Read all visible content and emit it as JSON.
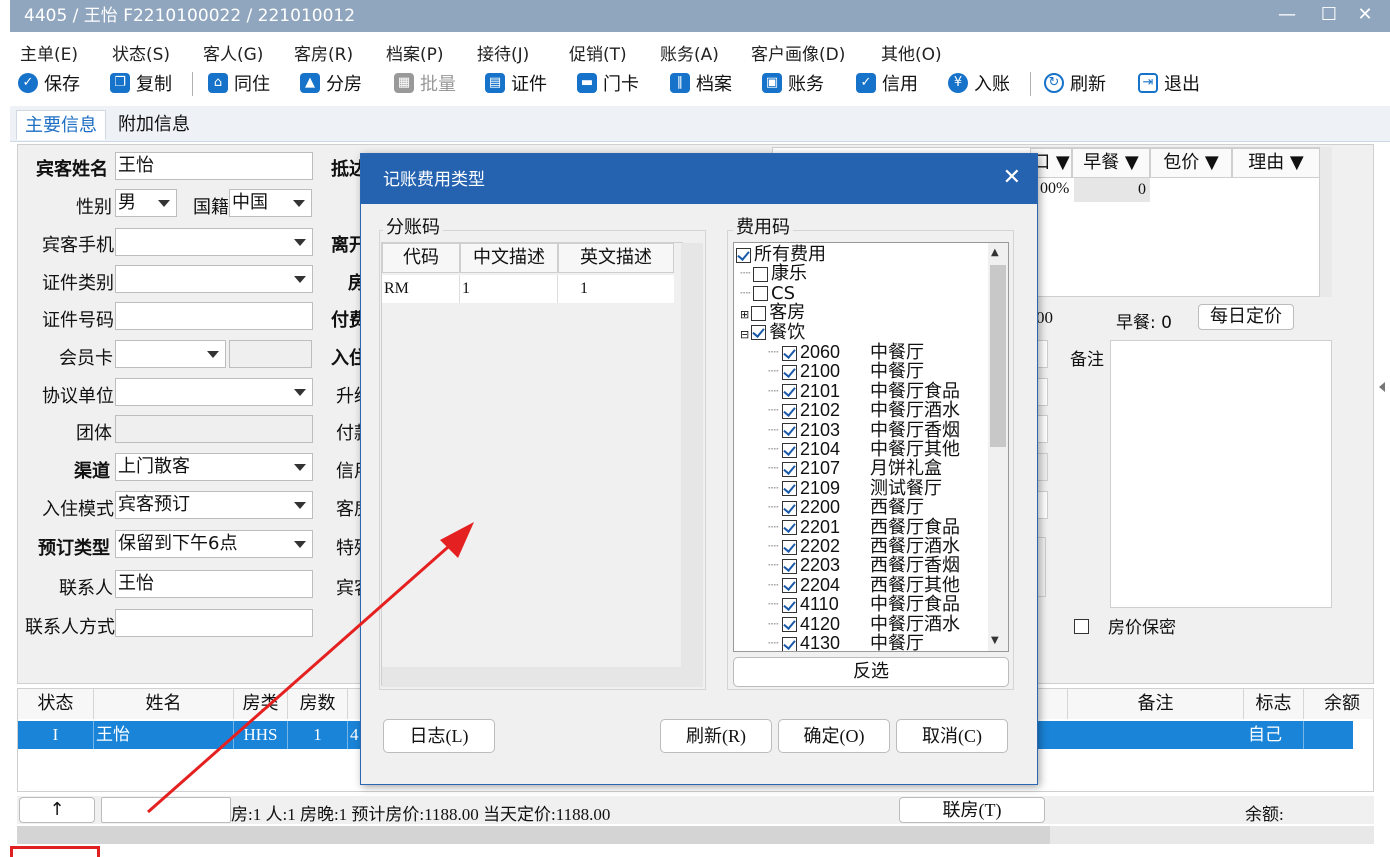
{
  "window": {
    "title": "4405 / 王怡 F2210100022 / 221010012",
    "min": "—",
    "max": "☐",
    "close": "✕"
  },
  "menu": [
    "主单(E)",
    "状态(S)",
    "客人(G)",
    "客房(R)",
    "档案(P)",
    "接待(J)",
    "促销(T)",
    "账务(A)",
    "客户画像(D)",
    "其他(O)"
  ],
  "toolbar": {
    "save": "保存",
    "copy": "复制",
    "cohabit": "同住",
    "assign": "分房",
    "batch": "批量",
    "idcard": "证件",
    "doorcard": "门卡",
    "profile": "档案",
    "account": "账务",
    "credit": "信用",
    "post": "入账",
    "refresh": "刷新",
    "exit": "退出"
  },
  "tabs": {
    "main": "主要信息",
    "extra": "附加信息"
  },
  "form": {
    "guest_name_label": "宾客姓名",
    "guest_name": "王怡",
    "gender_label": "性别",
    "gender": "男",
    "nation_label": "国籍",
    "nation": "中国",
    "phone_label": "宾客手机",
    "phone": "",
    "idtype_label": "证件类别",
    "idtype": "",
    "idno_label": "证件号码",
    "idno": "",
    "member_label": "会员卡",
    "member": "",
    "agreement_label": "协议单位",
    "agreement": "",
    "group_label": "团体",
    "group": "",
    "channel_label": "渠道",
    "channel": "上门散客",
    "checkin_mode_label": "入住模式",
    "checkin_mode": "宾客预订",
    "book_type_label": "预订类型",
    "book_type": "保留到下午6点",
    "contact_label": "联系人",
    "contact": "王怡",
    "contact_way_label": "联系人方式",
    "contact_way": "",
    "col2": [
      "抵达",
      "离开",
      "房",
      "付费",
      "入住",
      "升级",
      "付款",
      "信用",
      "客房",
      "特殊",
      "宾客"
    ]
  },
  "price_grid": {
    "headers": [
      "口 ▼",
      "早餐 ▼",
      "包价 ▼",
      "理由 ▼"
    ],
    "row": [
      "00%",
      "0",
      "",
      ""
    ]
  },
  "right": {
    "left_value": "00",
    "breakfast": "早餐: 0",
    "daily_price_btn": "每日定价",
    "remark_label": "备注",
    "price_secret": "房价保密"
  },
  "bottom_grid": {
    "headers": [
      "状态",
      "姓名",
      "房类",
      "房数",
      "备注",
      "标志",
      "余额"
    ],
    "row": {
      "status": "I",
      "name": "王怡",
      "type": "HHS",
      "count": "1",
      "extra": "4",
      "flag": "自己"
    }
  },
  "status_bar": {
    "up_btn": "↑",
    "summary": "房:1  人:1  房晚:1  预计房价:1188.00  当天定价:1188.00",
    "link_btn": "联房(T)",
    "balance": "余额:"
  },
  "dialog": {
    "title": "记账费用类型",
    "sub_title": "分账码",
    "sub_headers": [
      "代码",
      "中文描述",
      "英文描述"
    ],
    "sub_rows": [
      [
        "RM",
        "1",
        "1"
      ]
    ],
    "fee_title": "费用码",
    "tree_root": "所有费用",
    "tree_top": [
      "康乐",
      "CS",
      "客房",
      "餐饮"
    ],
    "items": [
      {
        "code": "2060",
        "name": "中餐厅"
      },
      {
        "code": "2100",
        "name": "中餐厅"
      },
      {
        "code": "2101",
        "name": "中餐厅食品"
      },
      {
        "code": "2102",
        "name": "中餐厅酒水"
      },
      {
        "code": "2103",
        "name": "中餐厅香烟"
      },
      {
        "code": "2104",
        "name": "中餐厅其他"
      },
      {
        "code": "2107",
        "name": "月饼礼盒"
      },
      {
        "code": "2109",
        "name": "测试餐厅"
      },
      {
        "code": "2200",
        "name": "西餐厅"
      },
      {
        "code": "2201",
        "name": "西餐厅食品"
      },
      {
        "code": "2202",
        "name": "西餐厅酒水"
      },
      {
        "code": "2203",
        "name": "西餐厅香烟"
      },
      {
        "code": "2204",
        "name": "西餐厅其他"
      },
      {
        "code": "4110",
        "name": "中餐厅食品"
      },
      {
        "code": "4120",
        "name": "中餐厅酒水"
      },
      {
        "code": "4130",
        "name": "中餐厅"
      }
    ],
    "invert_btn": "反选",
    "log_btn": "日志(L)",
    "refresh_btn": "刷新(R)",
    "ok_btn": "确定(O)",
    "cancel_btn": "取消(C)"
  }
}
